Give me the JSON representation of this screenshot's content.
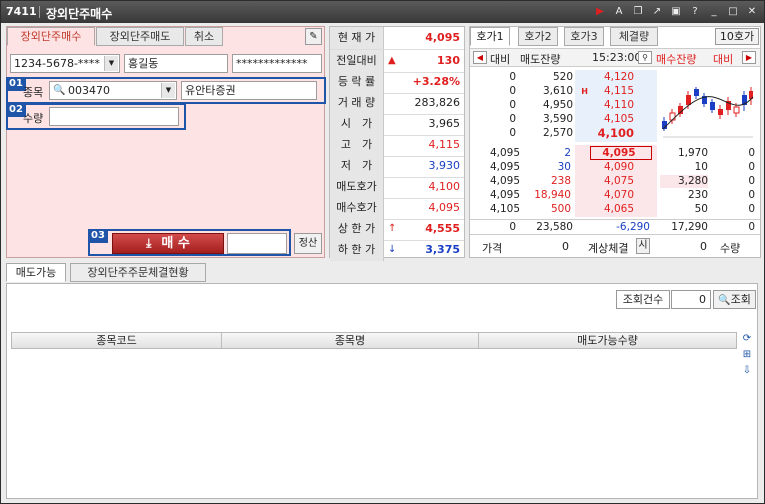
{
  "window": {
    "code": "7411",
    "title": "장외단주매수",
    "icons": [
      "play-icon",
      "font-icon",
      "copy-icon",
      "link-icon",
      "window-icon",
      "help-icon",
      "minimize-icon",
      "maximize-icon",
      "close-icon"
    ]
  },
  "left": {
    "tabs": [
      "장외단주매수",
      "장외단주매도",
      "취소"
    ],
    "account": {
      "number": "1234-5678-****",
      "name": "홍길동",
      "password": "*************"
    },
    "stock": {
      "badge": "01",
      "label": "종목",
      "code": "003470",
      "name": "유안타증권"
    },
    "qty": {
      "badge": "02",
      "label": "수량",
      "value": ""
    },
    "order": {
      "badge": "03",
      "buy_label": "매 수",
      "price": "",
      "calc_label": "정산"
    }
  },
  "quote": [
    {
      "label": "현 재 가",
      "value": "4,095",
      "color": "red",
      "bold": true
    },
    {
      "label": "전일대비",
      "arrow": "▲",
      "value": "130",
      "color": "red",
      "bold": true
    },
    {
      "label": "등 락 률",
      "value": "+3.28%",
      "color": "red",
      "bold": true
    },
    {
      "label": "거 래 량",
      "value": "283,826",
      "color": "black"
    },
    {
      "label": "시　가",
      "value": "3,965",
      "color": "black"
    },
    {
      "label": "고　가",
      "value": "4,115",
      "color": "red"
    },
    {
      "label": "저　가",
      "value": "3,930",
      "color": "blue"
    },
    {
      "label": "매도호가",
      "value": "4,100",
      "color": "red"
    },
    {
      "label": "매수호가",
      "value": "4,095",
      "color": "red"
    },
    {
      "label": "상 한 가",
      "arrow": "↑",
      "value": "4,555",
      "color": "red",
      "bold": true
    },
    {
      "label": "하 한 가",
      "arrow": "↓",
      "value": "3,375",
      "color": "blue",
      "bold": true
    }
  ],
  "hoga": {
    "tabs": [
      "호가1",
      "호가2",
      "호가3",
      "체결량"
    ],
    "button_10": "10호가",
    "header": {
      "daebi_left": "대비",
      "ask_label": "매도잔량",
      "time": "15:23:00",
      "bid_label": "매수잔량",
      "daebi_right": "대비"
    },
    "asks": [
      {
        "diff": "0",
        "qty": "520",
        "price": "4,120"
      },
      {
        "diff": "0",
        "qty": "3,610",
        "price": "4,115",
        "mark": "H"
      },
      {
        "diff": "0",
        "qty": "4,950",
        "price": "4,110"
      },
      {
        "diff": "0",
        "qty": "3,590",
        "price": "4,105"
      },
      {
        "diff": "0",
        "qty": "2,570",
        "price": "4,100"
      }
    ],
    "bids": [
      {
        "left": "4,095",
        "mid": "2",
        "price": "4,095",
        "qty": "1,970",
        "diff": "0"
      },
      {
        "left": "4,095",
        "mid": "30",
        "price": "4,090",
        "qty": "10",
        "diff": "0"
      },
      {
        "left": "4,095",
        "mid": "238",
        "price": "4,075",
        "qty": "3,280",
        "diff": "0"
      },
      {
        "left": "4,095",
        "mid": "18,940",
        "price": "4,070",
        "qty": "230",
        "diff": "0"
      },
      {
        "left": "4,105",
        "mid": "500",
        "price": "4,065",
        "qty": "50",
        "diff": "0"
      }
    ],
    "totals": {
      "left": "0",
      "ask_total": "23,580",
      "diff": "-6,290",
      "bid_total": "17,290",
      "right": "0"
    },
    "footer": {
      "price_label": "가격",
      "price_value": "0",
      "calc_label": "계상체결",
      "calc_btn": "시",
      "qty_value": "0",
      "qty_label": "수량"
    }
  },
  "bottom": {
    "tabs": [
      "매도가능",
      "장외단주주문체결현황"
    ],
    "query": {
      "label": "조회건수",
      "value": "0",
      "button": "조회"
    },
    "columns": [
      "종목코드",
      "종목명",
      "매도가능수량"
    ]
  }
}
